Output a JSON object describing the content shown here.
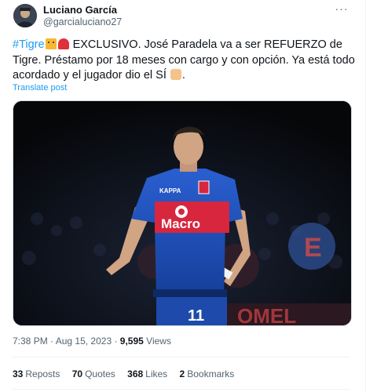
{
  "author": {
    "name": "Luciano García",
    "handle": "@garcialuciano27"
  },
  "more_menu_label": "···",
  "tweet": {
    "hashtag": "#Tigre",
    "text_part1": " EXCLUSIVO. José Paradela va a ser REFUERZO de Tigre. Préstamo por 18 meses con cargo y con opción. Ya está todo acordado y el jugador dio el SÍ",
    "text_part2": ".",
    "emojis": [
      "tiger-face-icon",
      "siren-icon",
      "writing-hand-icon"
    ]
  },
  "translate_label": "Translate post",
  "media": {
    "jersey_sponsor": "Macro",
    "jersey_number": "11",
    "jersey_brand": "KAPPA",
    "background_banner_text": "OMEL",
    "colors": {
      "jersey_blue": "#1f4fb5",
      "jersey_red": "#d7263d",
      "background": "#0a0a0f"
    }
  },
  "meta": {
    "time": "7:38 PM",
    "sep1": " · ",
    "date": "Aug 15, 2023",
    "sep2": " · ",
    "views_count": "9,595",
    "views_label": " Views"
  },
  "stats": [
    {
      "count": "33",
      "label": "Reposts"
    },
    {
      "count": "70",
      "label": "Quotes"
    },
    {
      "count": "368",
      "label": "Likes"
    },
    {
      "count": "2",
      "label": "Bookmarks"
    }
  ],
  "colors": {
    "link": "#1d9bf0",
    "secondary_text": "#536471",
    "primary_text": "#0f1419"
  }
}
